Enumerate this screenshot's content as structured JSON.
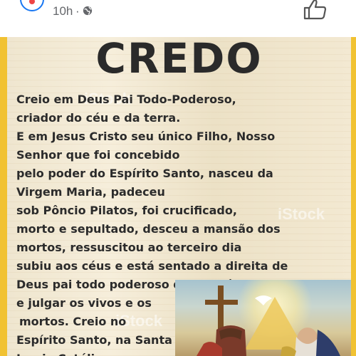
{
  "header": {
    "time": "10h",
    "separator": "·",
    "privacy_icon": "globe-icon",
    "like_icon": "thumbs-up-icon"
  },
  "post_image": {
    "title": "CREDO",
    "watermark": "iStock",
    "lines": [
      "Creio em Deus Pai Todo-Poderoso,",
      "criador do céu e da terra.",
      "E em Jesus Cristo seu único Filho, Nosso",
      "Senhor que foi concebido",
      "pelo poder do Espírito Santo, nasceu da",
      "Virgem Maria, padeceu",
      "sob Pôncio Pilatos, foi crucificado,",
      "morto e sepultado, desceu a mansão dos",
      "mortos, ressuscitou ao terceiro dia",
      "subiu aos céus e está sentado a direita de",
      "Deus pai todo poderoso donde há de vir",
      "e julgar os vivos e os",
      " mortos. Creio no",
      "Espírito Santo, na Santa",
      "Igreja Católica, na"
    ],
    "colors": {
      "frame": "#f1c232",
      "text": "#2b2b2b",
      "accent": "#1877f2"
    }
  }
}
